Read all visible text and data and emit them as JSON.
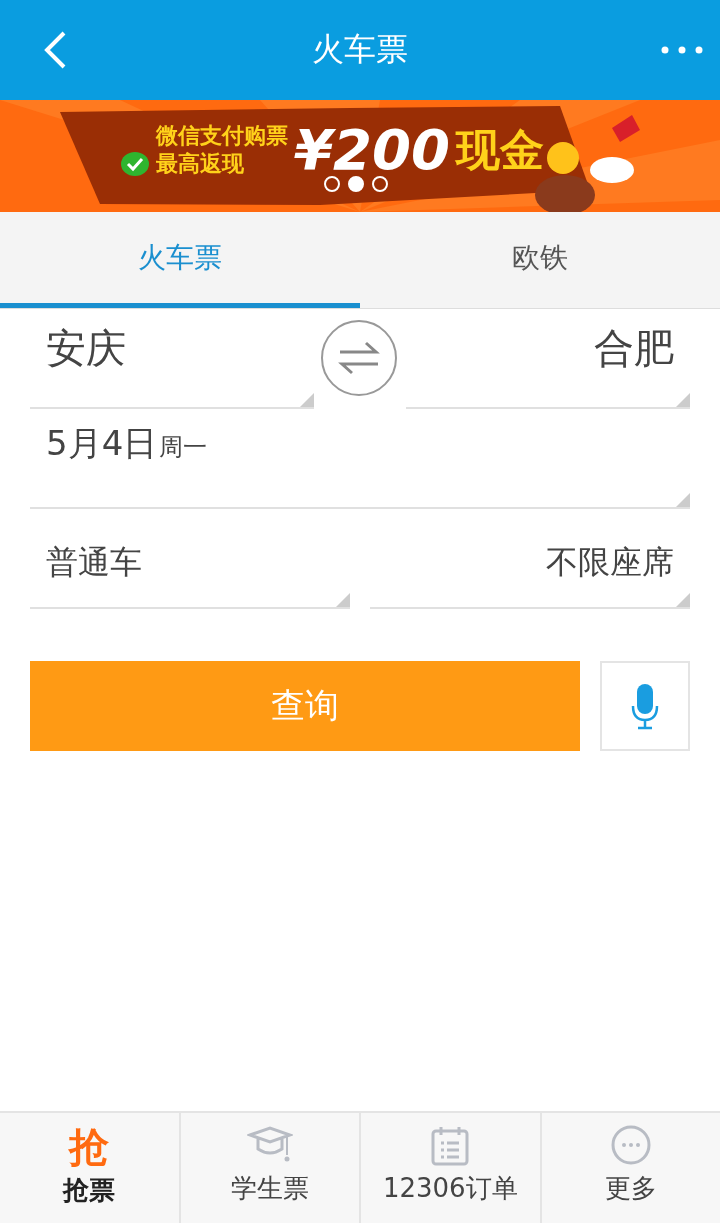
{
  "header": {
    "title": "火车票"
  },
  "banner": {
    "line_1": "微信支付购票",
    "line_2": "最高返现",
    "amount": "¥200",
    "cash": "现金",
    "dots": [
      {
        "selected": false
      },
      {
        "selected": true
      },
      {
        "selected": false
      }
    ]
  },
  "tabs": [
    {
      "label": "火车票",
      "selected": true
    },
    {
      "label": "欧铁",
      "selected": false
    }
  ],
  "route": {
    "from": "安庆",
    "to": "合肥"
  },
  "date": {
    "day": "5月4日",
    "weekday": "周一"
  },
  "train_type": "普通车",
  "seat": "不限座席",
  "search_button": "查询",
  "bottom_nav": [
    {
      "glyph": "抢",
      "label": "抢票",
      "selected": true,
      "kind": "glyph"
    },
    {
      "label": "学生票",
      "selected": false,
      "kind": "cap"
    },
    {
      "label": "12306订单",
      "selected": false,
      "kind": "calendar"
    },
    {
      "label": "更多",
      "selected": false,
      "kind": "chat"
    }
  ]
}
